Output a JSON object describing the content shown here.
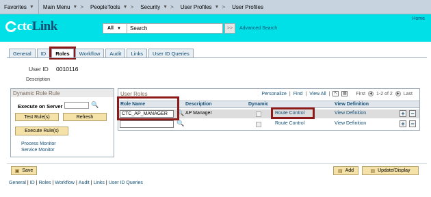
{
  "breadcrumb": {
    "favorites": "Favorites",
    "main_menu": "Main Menu",
    "people_tools": "PeopleTools",
    "security": "Security",
    "user_profiles": "User Profiles",
    "current": "User Profiles",
    "separator": ">"
  },
  "banner": {
    "logo_ctc": "ctc",
    "logo_link": "Link",
    "home": "Home",
    "search_scope": "All",
    "search_placeholder": "Search",
    "search_go": ">>",
    "advanced_search": "Advanced Search"
  },
  "tabs": [
    "General",
    "ID",
    "Roles",
    "Workflow",
    "Audit",
    "Links",
    "User ID Queries"
  ],
  "user": {
    "id_label": "User ID",
    "id_value": "0010116",
    "description_label": "Description"
  },
  "dynamic_role_rule": {
    "title": "Dynamic Role Rule",
    "execute_on_server_label": "Execute on Server",
    "test_rules": "Test Rule(s)",
    "refresh": "Refresh",
    "execute_rules": "Execute Rule(s)",
    "process_monitor": "Process Monitor",
    "service_monitor": "Service Monitor"
  },
  "user_roles": {
    "title": "User Roles",
    "personalize": "Personalize",
    "find": "Find",
    "view_all": "View All",
    "first": "First",
    "range": "1-2 of 2",
    "last": "Last",
    "columns": [
      "Role Name",
      "Description",
      "Dynamic",
      "",
      "View Definition"
    ],
    "rows": [
      {
        "role": "CTC_AP_MANAGER",
        "description": "AP Manager",
        "route": "Route Control",
        "view": "View Definition"
      },
      {
        "role": "",
        "description": "",
        "route": "Route Control",
        "view": "View Definition"
      }
    ]
  },
  "actions": {
    "save": "Save",
    "add": "Add",
    "update_display": "Update/Display"
  },
  "footer_links": [
    "General",
    "ID",
    "Roles",
    "Workflow",
    "Audit",
    "Links",
    "User ID Queries"
  ],
  "colors": {
    "banner": "#00e0e6",
    "highlight": "#8b1a1a",
    "link": "#124e74",
    "button": "#f5e2a8"
  }
}
